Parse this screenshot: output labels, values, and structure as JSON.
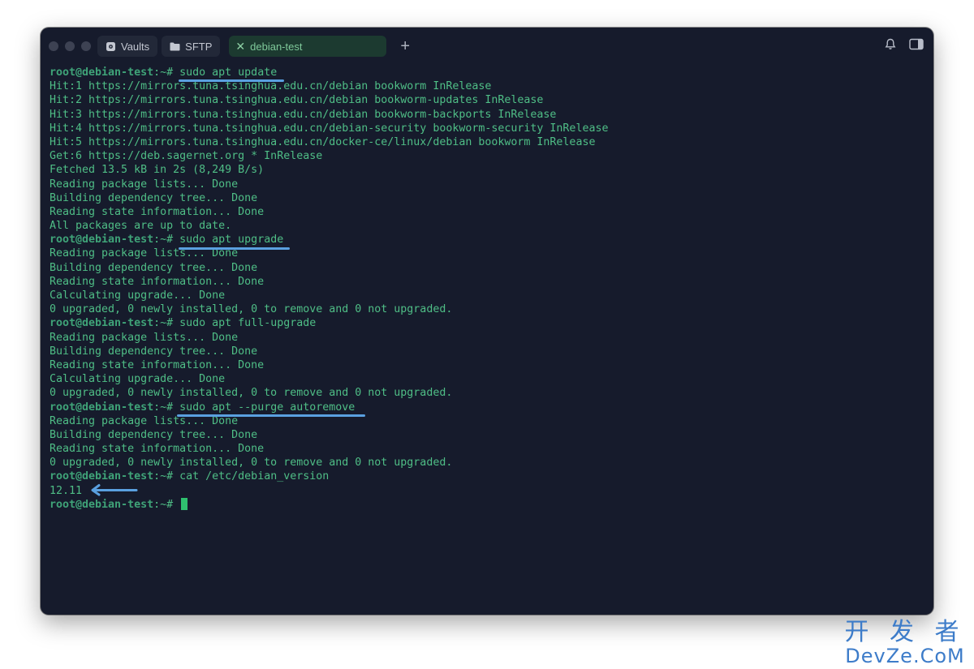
{
  "window": {
    "tabs": [
      {
        "label": "Vaults",
        "icon": "vault-icon"
      },
      {
        "label": "SFTP",
        "icon": "folder-icon"
      }
    ],
    "active_tab": {
      "label": "debian-test",
      "icon": "close-icon"
    },
    "new_tab_label": "+",
    "right_icons": [
      "bell-icon",
      "sidebar-icon"
    ]
  },
  "terminal": {
    "prompt": "root@debian-test",
    "lines": [
      {
        "kind": "cmd",
        "text": "sudo apt update"
      },
      {
        "kind": "out",
        "text": "Hit:1 https://mirrors.tuna.tsinghua.edu.cn/debian bookworm InRelease"
      },
      {
        "kind": "out",
        "text": "Hit:2 https://mirrors.tuna.tsinghua.edu.cn/debian bookworm-updates InRelease"
      },
      {
        "kind": "out",
        "text": "Hit:3 https://mirrors.tuna.tsinghua.edu.cn/debian bookworm-backports InRelease"
      },
      {
        "kind": "out",
        "text": "Hit:4 https://mirrors.tuna.tsinghua.edu.cn/debian-security bookworm-security InRelease"
      },
      {
        "kind": "out",
        "text": "Hit:5 https://mirrors.tuna.tsinghua.edu.cn/docker-ce/linux/debian bookworm InRelease"
      },
      {
        "kind": "out",
        "text": "Get:6 https://deb.sagernet.org * InRelease"
      },
      {
        "kind": "out",
        "text": "Fetched 13.5 kB in 2s (8,249 B/s)"
      },
      {
        "kind": "out",
        "text": "Reading package lists... Done"
      },
      {
        "kind": "out",
        "text": "Building dependency tree... Done"
      },
      {
        "kind": "out",
        "text": "Reading state information... Done"
      },
      {
        "kind": "out",
        "text": "All packages are up to date."
      },
      {
        "kind": "cmd",
        "text": "sudo apt upgrade"
      },
      {
        "kind": "out",
        "text": "Reading package lists... Done"
      },
      {
        "kind": "out",
        "text": "Building dependency tree... Done"
      },
      {
        "kind": "out",
        "text": "Reading state information... Done"
      },
      {
        "kind": "out",
        "text": "Calculating upgrade... Done"
      },
      {
        "kind": "out",
        "text": "0 upgraded, 0 newly installed, 0 to remove and 0 not upgraded."
      },
      {
        "kind": "cmd",
        "text": "sudo apt full-upgrade"
      },
      {
        "kind": "out",
        "text": "Reading package lists... Done"
      },
      {
        "kind": "out",
        "text": "Building dependency tree... Done"
      },
      {
        "kind": "out",
        "text": "Reading state information... Done"
      },
      {
        "kind": "out",
        "text": "Calculating upgrade... Done"
      },
      {
        "kind": "out",
        "text": "0 upgraded, 0 newly installed, 0 to remove and 0 not upgraded."
      },
      {
        "kind": "cmd",
        "text": "sudo apt --purge autoremove"
      },
      {
        "kind": "out",
        "text": "Reading package lists... Done"
      },
      {
        "kind": "out",
        "text": "Building dependency tree... Done"
      },
      {
        "kind": "out",
        "text": "Reading state information... Done"
      },
      {
        "kind": "out",
        "text": "0 upgraded, 0 newly installed, 0 to remove and 0 not upgraded."
      },
      {
        "kind": "cmd",
        "text": "cat /etc/debian_version"
      },
      {
        "kind": "out",
        "text": "12.11"
      },
      {
        "kind": "cmd",
        "text": ""
      }
    ]
  },
  "watermark": {
    "top": "开 发 者",
    "bottom": "DevZe.CoM"
  },
  "colors": {
    "terminal_bg": "#161b2c",
    "terminal_text": "#4fbe86",
    "annotation": "#5aa0e0",
    "active_tab_bg": "#1c3a30",
    "watermark": "#3d7cc9"
  }
}
